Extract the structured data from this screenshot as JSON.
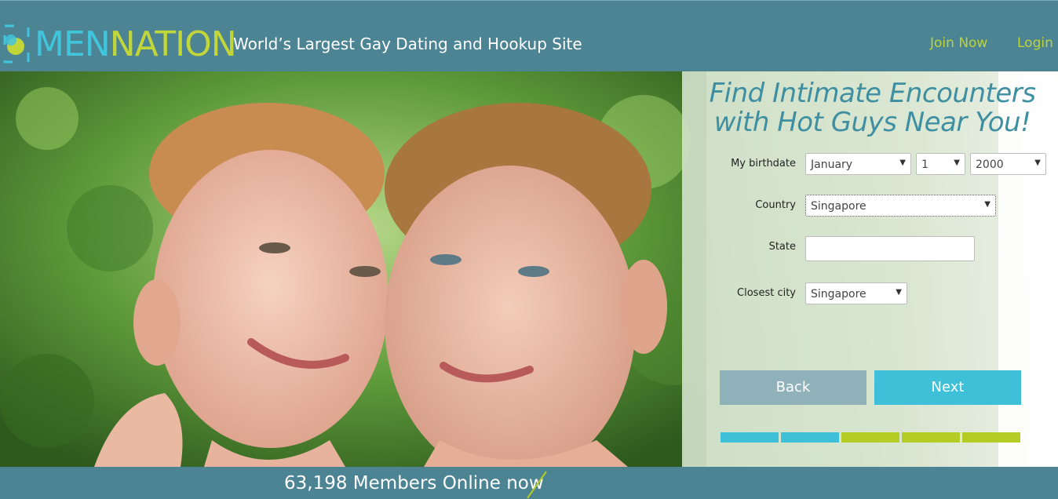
{
  "header": {
    "brand_part1": "MEN",
    "brand_part2": "NATION",
    "tagline": "World’s Largest Gay Dating and Hookup Site",
    "nav": {
      "join_label": "Join Now",
      "login_label": "Login"
    }
  },
  "hero": {
    "headline_line1": "Find Intimate Encounters",
    "headline_line2": "with Hot Guys Near You!"
  },
  "form": {
    "birthdate_label": "My birthdate",
    "birth_month": "January",
    "birth_day": "1",
    "birth_year": "2000",
    "country_label": "Country",
    "country_value": "Singapore",
    "state_label": "State",
    "state_value": "",
    "city_label": "Closest city",
    "city_value": "Singapore",
    "back_label": "Back",
    "next_label": "Next"
  },
  "progress": {
    "total_steps": 5,
    "completed_steps": 2,
    "colors": {
      "done": "#3ec0d8",
      "todo": "#b5cc24"
    }
  },
  "footer": {
    "members_online": "63,198 Members Online now"
  },
  "colors": {
    "header_bg": "#4c8494",
    "brand_cyan": "#41c5dd",
    "brand_green": "#c2d63a",
    "headline": "#3e8fa1",
    "next_button": "#3ec0d8",
    "back_button": "#8fb1ba"
  },
  "icons": [
    "mennation-logo-icon",
    "dropdown-arrow-icon",
    "slash-accent-icon"
  ]
}
